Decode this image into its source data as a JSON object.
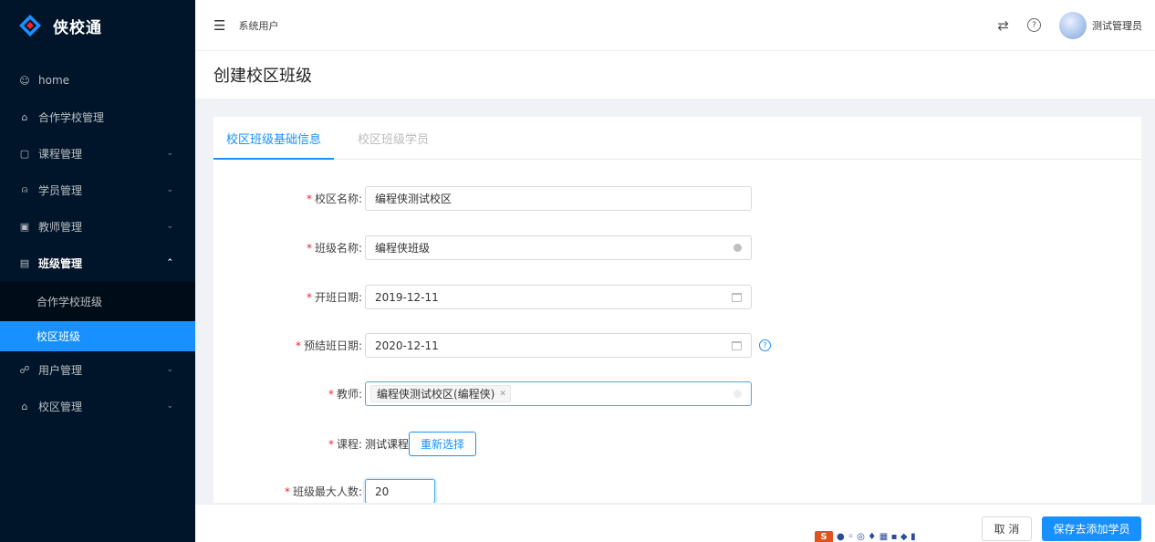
{
  "brand": {
    "name": "侠校通",
    "accent": "#1890ff",
    "sidebar_bg": "#001529"
  },
  "sidebar": {
    "items": [
      {
        "label": "home",
        "icon": "smile-icon"
      },
      {
        "label": "合作学校管理",
        "icon": "bank-icon"
      },
      {
        "label": "课程管理",
        "icon": "book-icon"
      },
      {
        "label": "学员管理",
        "icon": "team-icon"
      },
      {
        "label": "教师管理",
        "icon": "idcard-icon"
      },
      {
        "label": "班级管理",
        "icon": "table-icon"
      },
      {
        "label": "用户管理",
        "icon": "user-icon"
      },
      {
        "label": "校区管理",
        "icon": "home-icon"
      }
    ],
    "class_submenu": [
      {
        "label": "合作学校班级"
      },
      {
        "label": "校区班级"
      }
    ]
  },
  "header": {
    "title": "系统用户",
    "user_name": "测试管理员"
  },
  "page": {
    "title": "创建校区班级"
  },
  "tabs": [
    {
      "label": "校区班级基础信息"
    },
    {
      "label": "校区班级学员"
    }
  ],
  "form": {
    "campus_name": {
      "label": "校区名称:",
      "value": "编程侠测试校区"
    },
    "class_name": {
      "label": "班级名称:",
      "value": "编程侠班级"
    },
    "start_date": {
      "label": "开班日期:",
      "value": "2019-12-11"
    },
    "end_date": {
      "label": "预结班日期:",
      "value": "2020-12-11"
    },
    "teacher": {
      "label": "教师:",
      "tag": "编程侠测试校区(编程侠)"
    },
    "course": {
      "label": "课程:",
      "value": "测试课程",
      "button": "重新选择"
    },
    "max_students": {
      "label": "班级最大人数:",
      "value": "20"
    },
    "required_mark": "*"
  },
  "footer": {
    "cancel": "取 消",
    "submit": "保存去添加学员"
  }
}
